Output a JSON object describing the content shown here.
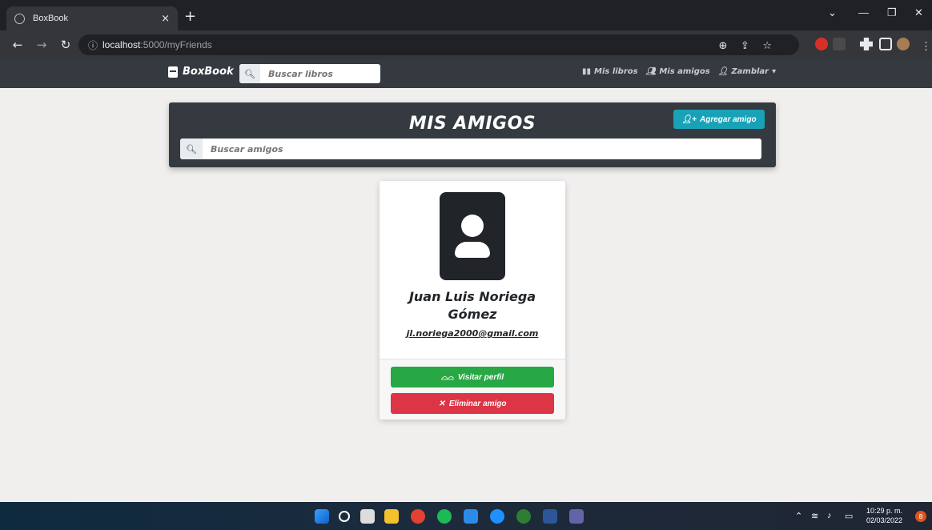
{
  "browser": {
    "tab_title": "BoxBook",
    "tab_close": "×",
    "new_tab": "+",
    "url_info_icon": "info-icon",
    "url_host": "localhost",
    "url_path": ":5000/myFriends"
  },
  "navbar": {
    "brand": "BoxBook",
    "search_placeholder": "Buscar libros",
    "links": {
      "my_books": "Mis libros",
      "my_friends": "Mis amigos",
      "user": "Zamblar"
    }
  },
  "header": {
    "title": "MIS AMIGOS",
    "add_button": "Agregar amigo",
    "search_placeholder": "Buscar amigos"
  },
  "friend": {
    "name_line1": "Juan Luis Noriega",
    "name_line2": "Gómez",
    "email": "jl.noriega2000@gmail.com",
    "visit_button": "Visitar perfil",
    "delete_button": "Eliminar amigo"
  },
  "taskbar": {
    "time": "10:29 p. m.",
    "date": "02/03/2022",
    "notifications": "8"
  },
  "colors": {
    "navbar_bg": "#343a40",
    "info": "#17a2b8",
    "success": "#28a745",
    "danger": "#dc3545"
  }
}
